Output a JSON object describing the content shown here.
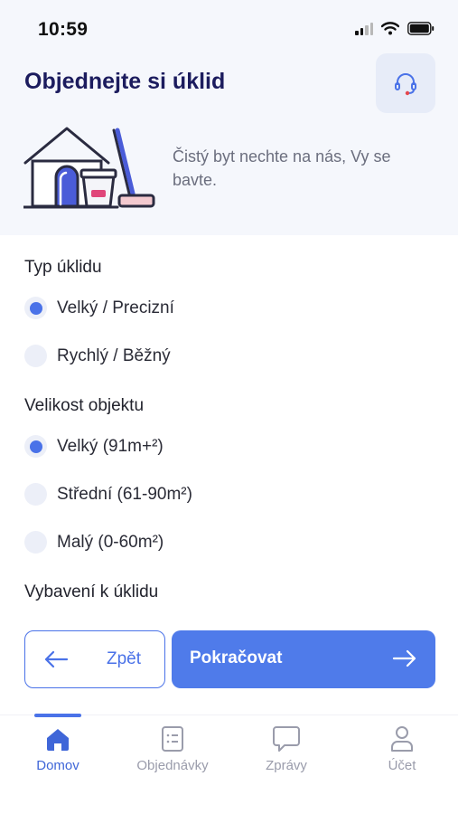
{
  "status_bar": {
    "time": "10:59"
  },
  "header": {
    "title": "Objednejte si úklid",
    "support_icon": "headset-icon",
    "hero_text": "Čistý byt nechte na nás, Vy se bavte."
  },
  "cleaning_type": {
    "label": "Typ úklidu",
    "options": [
      {
        "label": "Velký / Precizní",
        "selected": true
      },
      {
        "label": "Rychlý / Běžný",
        "selected": false
      }
    ]
  },
  "object_size": {
    "label": "Velikost objektu",
    "options": [
      {
        "label": "Velký (91m+²)",
        "selected": true
      },
      {
        "label": "Střední (61-90m²)",
        "selected": false
      },
      {
        "label": "Malý (0-60m²)",
        "selected": false
      }
    ]
  },
  "equipment": {
    "label": "Vybavení k úklidu"
  },
  "actions": {
    "back_label": "Zpět",
    "next_label": "Pokračovat"
  },
  "tab_bar": {
    "active": "Domov",
    "items": [
      {
        "label": "Domov",
        "icon": "home-icon"
      },
      {
        "label": "Objednávky",
        "icon": "orders-icon"
      },
      {
        "label": "Zprávy",
        "icon": "chat-icon"
      },
      {
        "label": "Účet",
        "icon": "user-icon"
      }
    ]
  },
  "colors": {
    "accent": "#4a72e8",
    "title": "#1c1c5e",
    "header_bg": "#f5f7fc"
  }
}
